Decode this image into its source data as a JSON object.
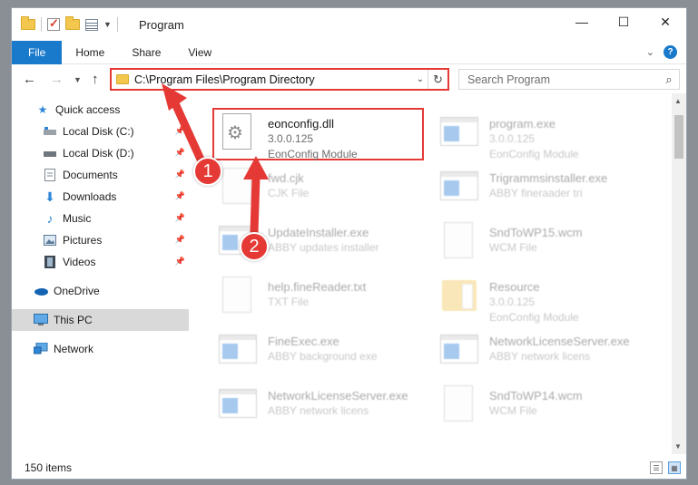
{
  "window": {
    "title": "Program",
    "controls": {
      "minimize": "—",
      "maximize": "☐",
      "close": "✕"
    }
  },
  "ribbon": {
    "tabs": [
      "File",
      "Home",
      "Share",
      "View"
    ],
    "expand": "⌄",
    "help": "?"
  },
  "address": {
    "path": "C:\\Program Files\\Program Directory",
    "dropdown": "⌄",
    "refresh": "↻"
  },
  "search": {
    "placeholder": "Search Program",
    "icon": "search-icon"
  },
  "navpane": {
    "items": [
      {
        "label": "Quick access",
        "icon": "star-icon"
      },
      {
        "label": "Local Disk (C:)",
        "icon": "drive-icon",
        "pinned": true
      },
      {
        "label": "Local Disk (D:)",
        "icon": "drive-icon",
        "pinned": true
      },
      {
        "label": "Documents",
        "icon": "documents-icon",
        "pinned": true
      },
      {
        "label": "Downloads",
        "icon": "download-icon",
        "pinned": true
      },
      {
        "label": "Music",
        "icon": "music-icon",
        "pinned": true
      },
      {
        "label": "Pictures",
        "icon": "pictures-icon",
        "pinned": true
      },
      {
        "label": "Videos",
        "icon": "videos-icon",
        "pinned": true
      },
      {
        "label": "OneDrive",
        "icon": "cloud-icon"
      },
      {
        "label": "This PC",
        "icon": "computer-icon",
        "selected": true
      },
      {
        "label": "Network",
        "icon": "network-icon"
      }
    ]
  },
  "files": [
    {
      "name": "eonconfig.dll",
      "line2": "3.0.0.125",
      "line3": "EonConfig Module",
      "type": "dll",
      "highlighted": true
    },
    {
      "name": "program.exe",
      "line2": "3.0.0.125",
      "line3": "EonConfig Module",
      "type": "exe"
    },
    {
      "name": "fwd.cjk",
      "line2": "CJK File",
      "line3": "",
      "type": "doc"
    },
    {
      "name": "Trigrammsinstaller.exe",
      "line2": "ABBY fineraader tri",
      "line3": "",
      "type": "exe"
    },
    {
      "name": "UpdateInstaller.exe",
      "line2": "ABBY updates installer",
      "line3": "",
      "type": "exe"
    },
    {
      "name": "SndToWP15.wcm",
      "line2": "WCM File",
      "line3": "",
      "type": "doc"
    },
    {
      "name": "help.fineReader.txt",
      "line2": "TXT File",
      "line3": "",
      "type": "doc"
    },
    {
      "name": "Resource",
      "line2": "3.0.0.125",
      "line3": "EonConfig Module",
      "type": "folder"
    },
    {
      "name": "FineExec.exe",
      "line2": "ABBY background exe",
      "line3": "",
      "type": "exe"
    },
    {
      "name": "NetworkLicenseServer.exe",
      "line2": "ABBY network licens",
      "line3": "",
      "type": "exe"
    },
    {
      "name": "NetworkLicenseServer.exe",
      "line2": "ABBY network licens",
      "line3": "",
      "type": "exe"
    },
    {
      "name": "SndToWP14.wcm",
      "line2": "WCM File",
      "line3": "",
      "type": "doc"
    }
  ],
  "status": {
    "count": "150 items"
  },
  "annotations": {
    "step1": "1",
    "step2": "2",
    "color": "#e53935"
  },
  "colors": {
    "accent": "#1979ca",
    "annotation": "#e53935",
    "selected": "#d9d9d9"
  }
}
